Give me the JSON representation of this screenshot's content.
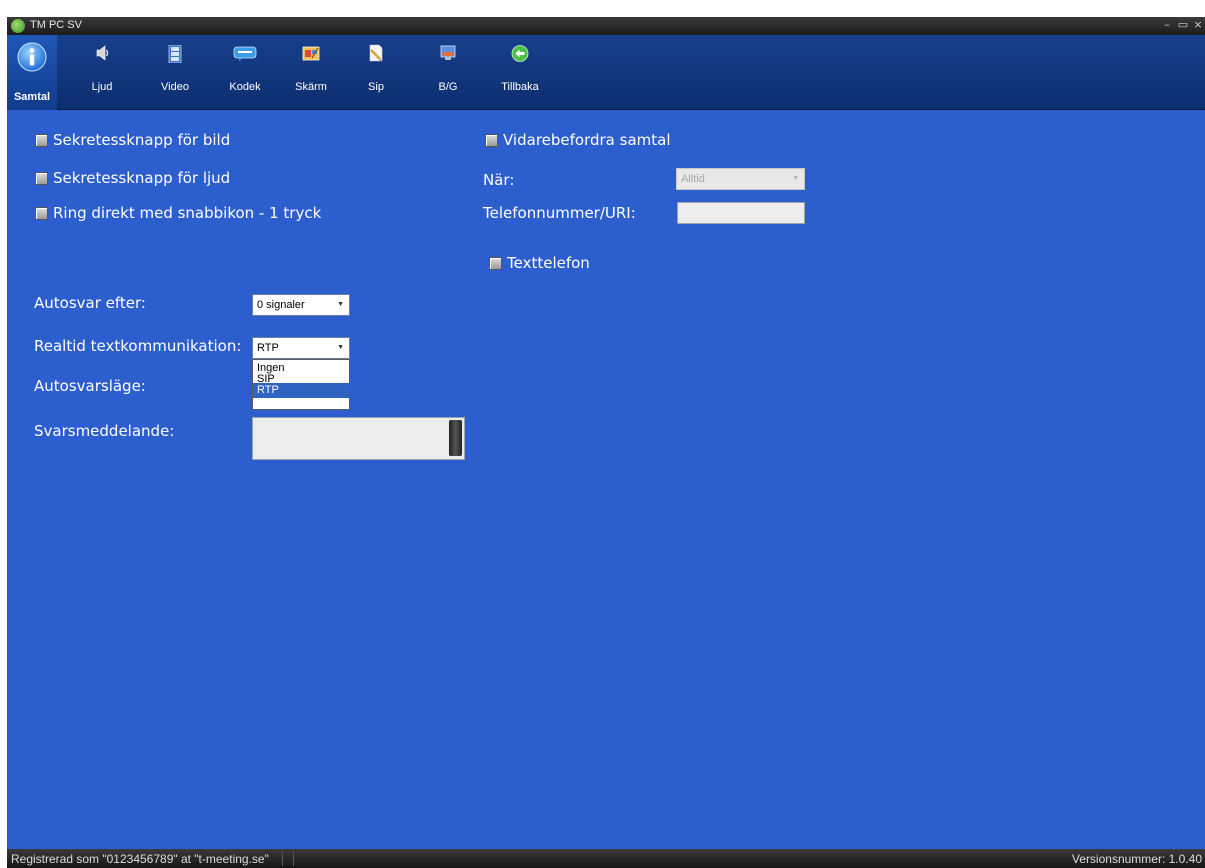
{
  "window": {
    "title": "TM PC SV",
    "logo_icon": "app-logo-icon",
    "minimize": "–",
    "maximize": "▭",
    "close": "×"
  },
  "toolbar": {
    "items": [
      {
        "label": "Samtal",
        "icon": "info-icon",
        "active": true
      },
      {
        "label": "Ljud",
        "icon": "speaker-icon"
      },
      {
        "label": "Video",
        "icon": "film-icon"
      },
      {
        "label": "Kodek",
        "icon": "codec-icon"
      },
      {
        "label": "Skärm",
        "icon": "screen-icon"
      },
      {
        "label": "Sip",
        "icon": "pencil-paper-icon"
      },
      {
        "label": "B/G",
        "icon": "monitor-icon"
      },
      {
        "label": "Tillbaka",
        "icon": "back-arrow-icon"
      }
    ]
  },
  "form": {
    "privacy_video": {
      "label": "Sekretessknapp för bild",
      "checked": false
    },
    "privacy_audio": {
      "label": "Sekretessknapp för ljud",
      "checked": false
    },
    "ring_direct": {
      "label": "Ring direkt med snabbikon - 1 tryck",
      "checked": false
    },
    "forward_call": {
      "label": "Vidarebefordra samtal",
      "checked": false
    },
    "when": {
      "label": "När:",
      "value": "Alltid",
      "disabled": true
    },
    "phone_uri": {
      "label": "Telefonnummer/URI:",
      "value": ""
    },
    "text_phone": {
      "label": "Texttelefon",
      "checked": false
    },
    "autoanswer_after": {
      "label": "Autosvar efter:",
      "value": "0 signaler"
    },
    "realtime_text": {
      "label": "Realtid textkommunikation:",
      "value": "RTP",
      "options": [
        "Ingen",
        "SIP",
        "RTP"
      ],
      "open": true
    },
    "autoanswer_mode": {
      "label": "Autosvarsläge:"
    },
    "reply_message": {
      "label": "Svarsmeddelande:",
      "value": ""
    }
  },
  "status": {
    "left": "Registrerad som \"0123456789\" at \"t-meeting.se\"",
    "right": "Versionsnummer: 1.0.40"
  },
  "colors": {
    "background": "#2c5fcd",
    "toolbar": "#0d2d6f",
    "selected": "#2f64c2"
  }
}
